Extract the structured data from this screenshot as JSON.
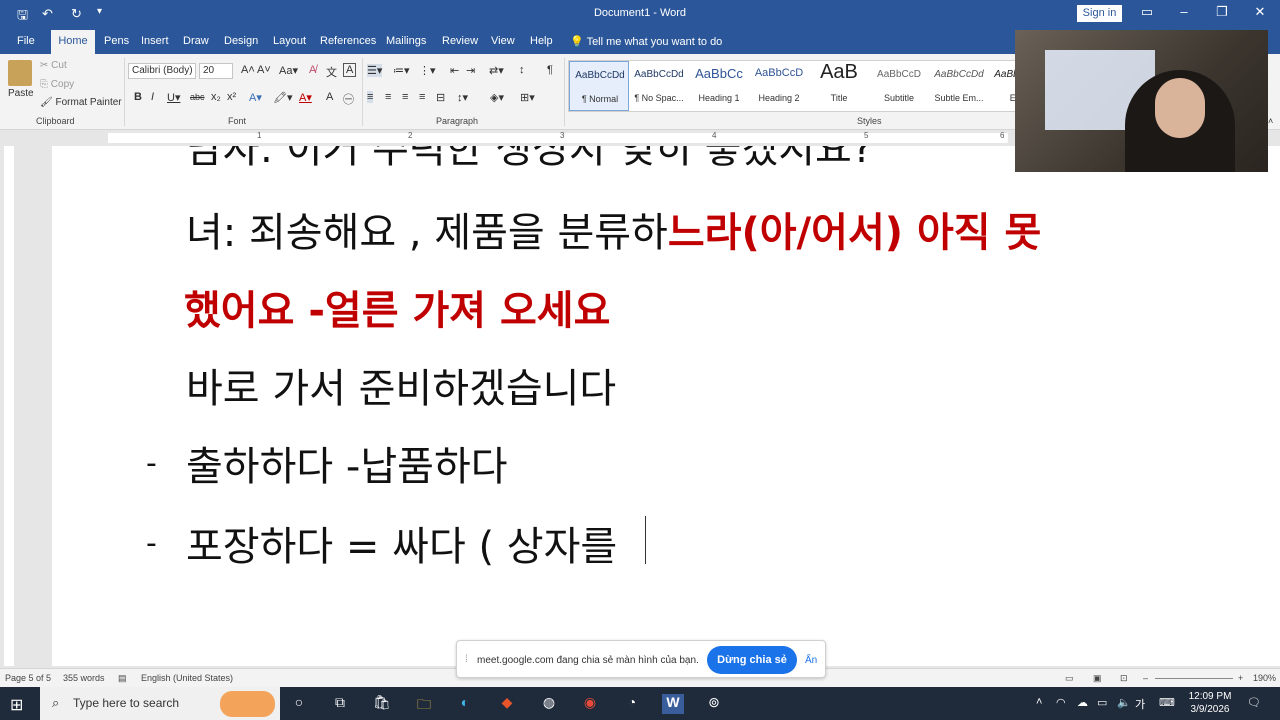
{
  "window": {
    "doc_title": "Document1  -  Word",
    "sign_in": "Sign in"
  },
  "tabs": [
    "File",
    "Home",
    "Pens",
    "Insert",
    "Draw",
    "Design",
    "Layout",
    "References",
    "Mailings",
    "Review",
    "View",
    "Help"
  ],
  "tell_me": "Tell me what you want to do",
  "ribbon": {
    "clipboard": {
      "paste": "Paste",
      "cut": "Cut",
      "copy": "Copy",
      "format_painter": "Format Painter",
      "label": "Clipboard"
    },
    "font": {
      "name": "Calibri (Body)",
      "size": "20",
      "label": "Font"
    },
    "paragraph": {
      "label": "Paragraph"
    },
    "styles": {
      "label": "Styles",
      "items": [
        {
          "preview": "AaBbCcDd",
          "name": "¶ Normal"
        },
        {
          "preview": "AaBbCcDd",
          "name": "¶ No Spac..."
        },
        {
          "preview": "AaBbCc",
          "name": "Heading 1"
        },
        {
          "preview": "AaBbCcD",
          "name": "Heading 2"
        },
        {
          "preview": "AaB",
          "name": "Title"
        },
        {
          "preview": "AaBbCcD",
          "name": "Subtitle"
        },
        {
          "preview": "AaBbCcDd",
          "name": "Subtle Em..."
        },
        {
          "preview": "AaBbCcDd",
          "name": "Emp"
        }
      ]
    }
  },
  "ruler_ticks": [
    "1",
    "2",
    "3",
    "4",
    "5",
    "6"
  ],
  "document": {
    "line0": "남자: 이거 주럭한 생성지 잊히 좋겠지요?",
    "line1_plain": "녀: 죄송해요 , 제품을 분류하",
    "line1_red": "느라(아/어서) 아직 못",
    "line2_red": "했어요 -얼른 가져 오세요",
    "line3": "바로 가서 준비하겠습니다",
    "bullet1": "출하하다 -납품하다",
    "bullet2": "포장하다 = 싸다 ( 상자를",
    "dash": "-"
  },
  "status": {
    "page": "Page 5 of 5",
    "words": "355 words",
    "language": "English (United States)",
    "zoom": "190%"
  },
  "share_banner": {
    "text": "meet.google.com đang chia sẻ màn hình của bạn.",
    "stop": "Dừng chia sẻ",
    "hide": "Ẩn"
  },
  "taskbar": {
    "search_placeholder": "Type here to search",
    "time": "12:09 PM",
    "date": "3/9/2026",
    "ime": "가"
  },
  "colors": {
    "word_blue": "#2b579a",
    "red_text": "#c00000",
    "share_blue": "#1a73e8"
  }
}
